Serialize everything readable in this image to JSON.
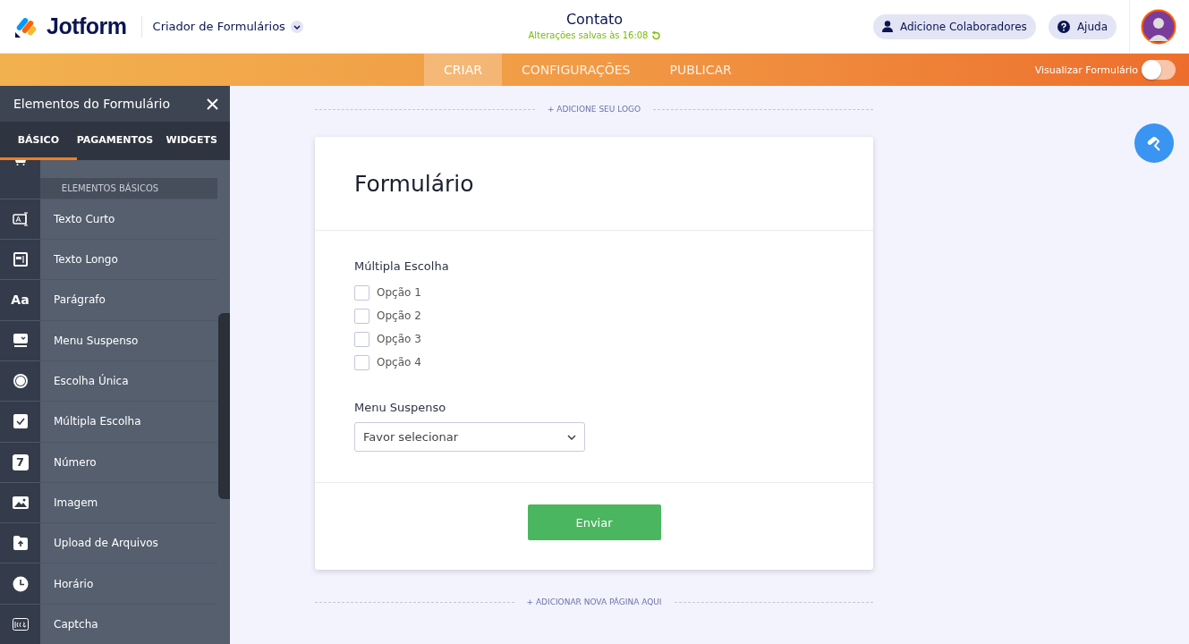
{
  "header": {
    "brand": "Jotform",
    "app_menu": "Criador de Formulários",
    "title": "Contato",
    "save_status": "Alterações salvas às 16:08",
    "buttons": [
      {
        "kind": "collaborators",
        "label": "Adicione Colaboradores"
      },
      {
        "kind": "help",
        "label": "Ajuda"
      }
    ]
  },
  "nav": {
    "tabs": [
      {
        "label": "CRIAR",
        "selected": true
      },
      {
        "label": "CONFIGURAÇÕES",
        "selected": false
      },
      {
        "label": "PUBLICAR",
        "selected": false
      }
    ],
    "preview": {
      "label": "Visualizar Formulário",
      "on": false
    }
  },
  "sidebar": {
    "title": "Elementos do Formulário",
    "tabs": [
      {
        "label": "BÁSICO",
        "selected": true
      },
      {
        "label": "PAGAMENTOS",
        "selected": false
      },
      {
        "label": "WIDGETS",
        "selected": false
      }
    ],
    "section": "ELEMENTOS BÁSICOS",
    "items": [
      {
        "label": "Texto Curto"
      },
      {
        "label": "Texto Longo"
      },
      {
        "label": "Parágrafo",
        "icon_text": "Aa"
      },
      {
        "label": "Menu Suspenso"
      },
      {
        "label": "Escolha Única"
      },
      {
        "label": "Múltipla Escolha"
      },
      {
        "label": "Número",
        "icon_text": "7"
      },
      {
        "label": "Imagem"
      },
      {
        "label": "Upload de Arquivos"
      },
      {
        "label": "Horário"
      },
      {
        "label": "Captcha"
      }
    ]
  },
  "canvas": {
    "add_logo": "+ ADICIONE SEU LOGO",
    "form": {
      "title": "Formulário",
      "questions": [
        {
          "kind": "checkbox",
          "label": "Múltipla Escolha",
          "options": [
            {
              "label": "Opção 1",
              "checked": false
            },
            {
              "label": "Opção 2",
              "checked": false
            },
            {
              "label": "Opção 3",
              "checked": false
            },
            {
              "label": "Opção 4",
              "checked": false
            }
          ]
        },
        {
          "kind": "dropdown",
          "label": "Menu Suspenso",
          "placeholder": "Favor selecionar"
        }
      ],
      "submit": "Enviar"
    },
    "add_page": "+ ADICIONAR NOVA PÁGINA AQUI"
  }
}
